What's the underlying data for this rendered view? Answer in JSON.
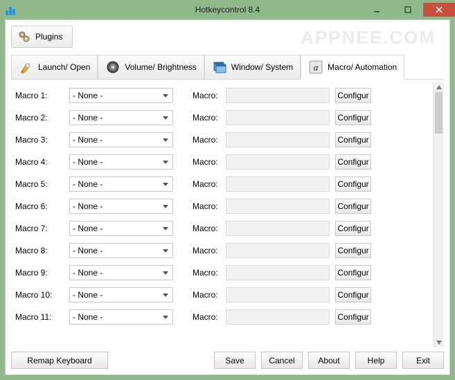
{
  "window": {
    "title": "Hotkeycontrol 8.4"
  },
  "watermark": "APPNEE.COM",
  "plugins_label": "Plugins",
  "tabs": [
    {
      "label": "Launch/ Open"
    },
    {
      "label": "Volume/ Brightness"
    },
    {
      "label": "Window/ System"
    },
    {
      "label": "Macro/ Automation"
    }
  ],
  "macro_second_label": "Macro:",
  "dropdown_none": "- None -",
  "configure_label": "Configur",
  "rows": [
    {
      "label": "Macro 1:"
    },
    {
      "label": "Macro 2:"
    },
    {
      "label": "Macro 3:"
    },
    {
      "label": "Macro 4:"
    },
    {
      "label": "Macro 5:"
    },
    {
      "label": "Macro 6:"
    },
    {
      "label": "Macro 7:"
    },
    {
      "label": "Macro 8:"
    },
    {
      "label": "Macro 9:"
    },
    {
      "label": "Macro 10:"
    },
    {
      "label": "Macro 11:"
    }
  ],
  "footer": {
    "remap": "Remap Keyboard",
    "save": "Save",
    "cancel": "Cancel",
    "about": "About",
    "help": "Help",
    "exit": "Exit"
  }
}
